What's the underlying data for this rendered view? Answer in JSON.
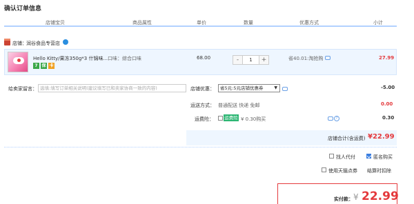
{
  "page": {
    "title": "确认订单信息"
  },
  "columns": [
    "店铺宝贝",
    "商品属性",
    "单价",
    "数量",
    "优惠方式",
    "小计"
  ],
  "shop": {
    "label": "店铺：",
    "name": "润谷食品专营店"
  },
  "item": {
    "title": "Hello Kitty/果冻350g*3 什锦味...",
    "attr": "口味：综合口味",
    "price": "68.00",
    "quantity": "1",
    "minus": "-",
    "plus": "+",
    "discount": "省40.01:淘抢购",
    "subtotal": "27.99",
    "badges": [
      "7",
      "保",
      "卡"
    ]
  },
  "memo": {
    "label": "给卖家留言：",
    "placeholder": "选填:填写订单相关说明(建议填写已和卖家协商一致的内容)"
  },
  "shop_discount": {
    "label": "店铺优惠：",
    "selected": "省5元:5元店铺优惠券",
    "amount": "-5.00"
  },
  "shipping": {
    "label": "运送方式：",
    "method": "普通配送 快递 免邮",
    "amount": "0.00"
  },
  "insurance": {
    "label": "运费险：",
    "tag": "运费险",
    "desc": "¥ 0.30购买",
    "amount": "0.30"
  },
  "shop_total": {
    "label": "店铺合计(含运费)",
    "amount": "¥22.99"
  },
  "options": {
    "proxy_pay": "找人代付",
    "anonymous": "匿名购买",
    "tmall_points": "使用天猫点券",
    "settle_balance": "结算时扣除"
  },
  "summary": {
    "label": "实付款：",
    "currency": "¥",
    "amount": "22.99"
  },
  "colors": {
    "accent": "#e4393c",
    "blue_line": "#b2d1ff",
    "row_bg": "#eef6ff",
    "insurance_green": "#2cb673"
  }
}
